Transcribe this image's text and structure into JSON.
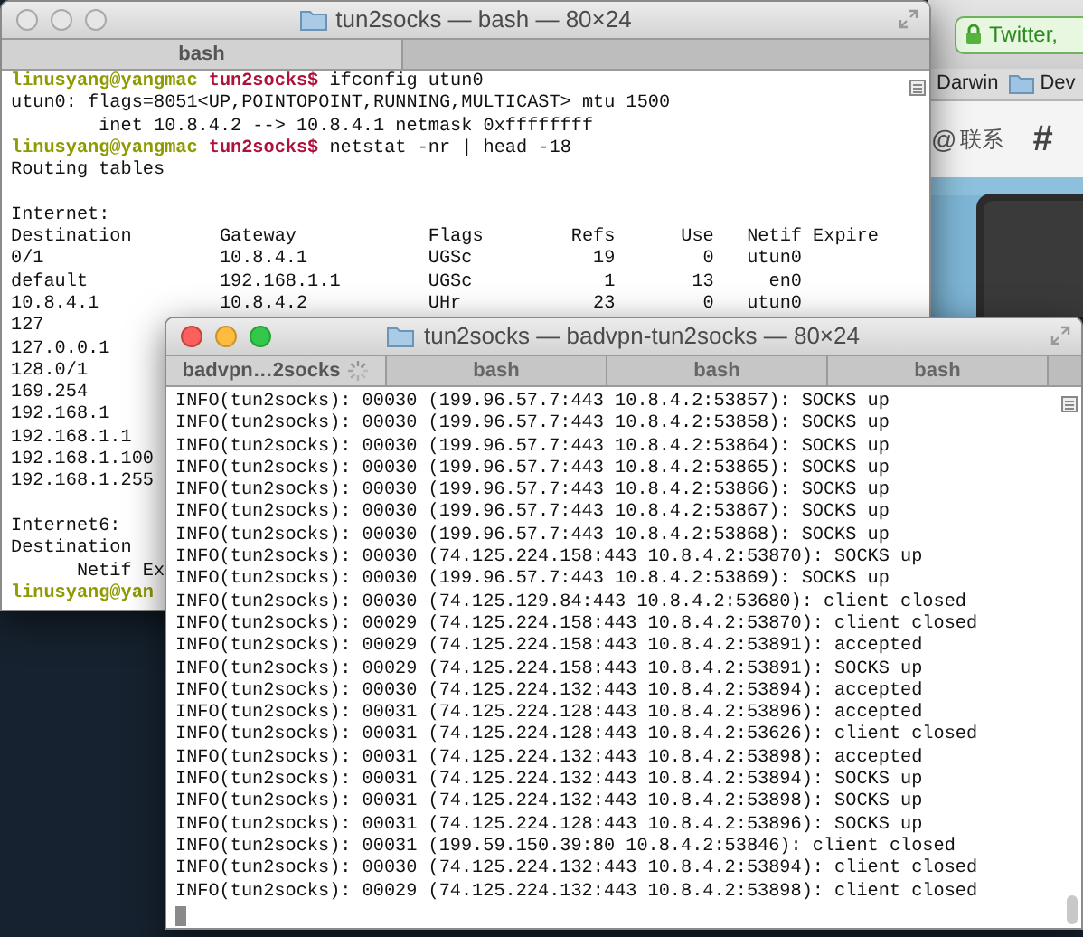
{
  "browser": {
    "address": "Twitter,",
    "bookmarks": [
      {
        "kind": "link",
        "label": "Darwin"
      },
      {
        "kind": "folder",
        "label": "Dev"
      }
    ],
    "nav": [
      {
        "icon": "@",
        "label": "联系"
      },
      {
        "icon": "#"
      }
    ]
  },
  "windows": [
    {
      "title": "tun2socks — bash — 80×24",
      "active": false,
      "tabs": [
        {
          "label": "bash",
          "selected": true
        }
      ],
      "lines": [
        {
          "kind": "prompt",
          "user": "linusyang@yangmac",
          "path": "tun2socks$",
          "command": "ifconfig utun0"
        },
        {
          "kind": "output",
          "text": "utun0: flags=8051<UP,POINTOPOINT,RUNNING,MULTICAST> mtu 1500"
        },
        {
          "kind": "output",
          "text": "        inet 10.8.4.2 --> 10.8.4.1 netmask 0xffffffff"
        },
        {
          "kind": "prompt",
          "user": "linusyang@yangmac",
          "path": "tun2socks$",
          "command": "netstat -nr | head -18"
        },
        {
          "kind": "output",
          "text": "Routing tables"
        },
        {
          "kind": "blank"
        },
        {
          "kind": "output",
          "text": "Internet:"
        },
        {
          "kind": "output",
          "text": "Destination        Gateway            Flags        Refs      Use   Netif Expire"
        },
        {
          "kind": "output",
          "text": "0/1                10.8.4.1           UGSc           19        0   utun0"
        },
        {
          "kind": "output",
          "text": "default            192.168.1.1        UGSc            1       13     en0"
        },
        {
          "kind": "output",
          "text": "10.8.4.1           10.8.4.2           UHr            23        0   utun0"
        },
        {
          "kind": "output",
          "text": "127"
        },
        {
          "kind": "output",
          "text": "127.0.0.1"
        },
        {
          "kind": "output",
          "text": "128.0/1"
        },
        {
          "kind": "output",
          "text": "169.254"
        },
        {
          "kind": "output",
          "text": "192.168.1"
        },
        {
          "kind": "output",
          "text": "192.168.1.1"
        },
        {
          "kind": "output",
          "text": "192.168.1.100"
        },
        {
          "kind": "output",
          "text": "192.168.1.255"
        },
        {
          "kind": "blank"
        },
        {
          "kind": "output",
          "text": "Internet6:"
        },
        {
          "kind": "output",
          "text": "Destination"
        },
        {
          "kind": "output",
          "text": "      Netif Ex"
        },
        {
          "kind": "prompt",
          "user": "linusyang@yan"
        }
      ]
    },
    {
      "title": "tun2socks — badvpn-tun2socks — 80×24",
      "active": true,
      "cursor": true,
      "tabs": [
        {
          "label": "badvpn…2socks",
          "selected": true,
          "busy": true
        },
        {
          "label": "bash",
          "selected": false
        },
        {
          "label": "bash",
          "selected": false
        },
        {
          "label": "bash",
          "selected": false
        }
      ],
      "lines": [
        {
          "kind": "output",
          "text": "INFO(tun2socks): 00030 (199.96.57.7:443 10.8.4.2:53857): SOCKS up"
        },
        {
          "kind": "output",
          "text": "INFO(tun2socks): 00030 (199.96.57.7:443 10.8.4.2:53858): SOCKS up"
        },
        {
          "kind": "output",
          "text": "INFO(tun2socks): 00030 (199.96.57.7:443 10.8.4.2:53864): SOCKS up"
        },
        {
          "kind": "output",
          "text": "INFO(tun2socks): 00030 (199.96.57.7:443 10.8.4.2:53865): SOCKS up"
        },
        {
          "kind": "output",
          "text": "INFO(tun2socks): 00030 (199.96.57.7:443 10.8.4.2:53866): SOCKS up"
        },
        {
          "kind": "output",
          "text": "INFO(tun2socks): 00030 (199.96.57.7:443 10.8.4.2:53867): SOCKS up"
        },
        {
          "kind": "output",
          "text": "INFO(tun2socks): 00030 (199.96.57.7:443 10.8.4.2:53868): SOCKS up"
        },
        {
          "kind": "output",
          "text": "INFO(tun2socks): 00030 (74.125.224.158:443 10.8.4.2:53870): SOCKS up"
        },
        {
          "kind": "output",
          "text": "INFO(tun2socks): 00030 (199.96.57.7:443 10.8.4.2:53869): SOCKS up"
        },
        {
          "kind": "output",
          "text": "INFO(tun2socks): 00030 (74.125.129.84:443 10.8.4.2:53680): client closed"
        },
        {
          "kind": "output",
          "text": "INFO(tun2socks): 00029 (74.125.224.158:443 10.8.4.2:53870): client closed"
        },
        {
          "kind": "output",
          "text": "INFO(tun2socks): 00029 (74.125.224.158:443 10.8.4.2:53891): accepted"
        },
        {
          "kind": "output",
          "text": "INFO(tun2socks): 00029 (74.125.224.158:443 10.8.4.2:53891): SOCKS up"
        },
        {
          "kind": "output",
          "text": "INFO(tun2socks): 00030 (74.125.224.132:443 10.8.4.2:53894): accepted"
        },
        {
          "kind": "output",
          "text": "INFO(tun2socks): 00031 (74.125.224.128:443 10.8.4.2:53896): accepted"
        },
        {
          "kind": "output",
          "text": "INFO(tun2socks): 00031 (74.125.224.128:443 10.8.4.2:53626): client closed"
        },
        {
          "kind": "output",
          "text": "INFO(tun2socks): 00031 (74.125.224.132:443 10.8.4.2:53898): accepted"
        },
        {
          "kind": "output",
          "text": "INFO(tun2socks): 00031 (74.125.224.132:443 10.8.4.2:53894): SOCKS up"
        },
        {
          "kind": "output",
          "text": "INFO(tun2socks): 00031 (74.125.224.132:443 10.8.4.2:53898): SOCKS up"
        },
        {
          "kind": "output",
          "text": "INFO(tun2socks): 00031 (74.125.224.128:443 10.8.4.2:53896): SOCKS up"
        },
        {
          "kind": "output",
          "text": "INFO(tun2socks): 00031 (199.59.150.39:80 10.8.4.2:53846): client closed"
        },
        {
          "kind": "output",
          "text": "INFO(tun2socks): 00030 (74.125.224.132:443 10.8.4.2:53894): client closed"
        },
        {
          "kind": "output",
          "text": "INFO(tun2socks): 00029 (74.125.224.132:443 10.8.4.2:53898): client closed"
        }
      ]
    }
  ]
}
